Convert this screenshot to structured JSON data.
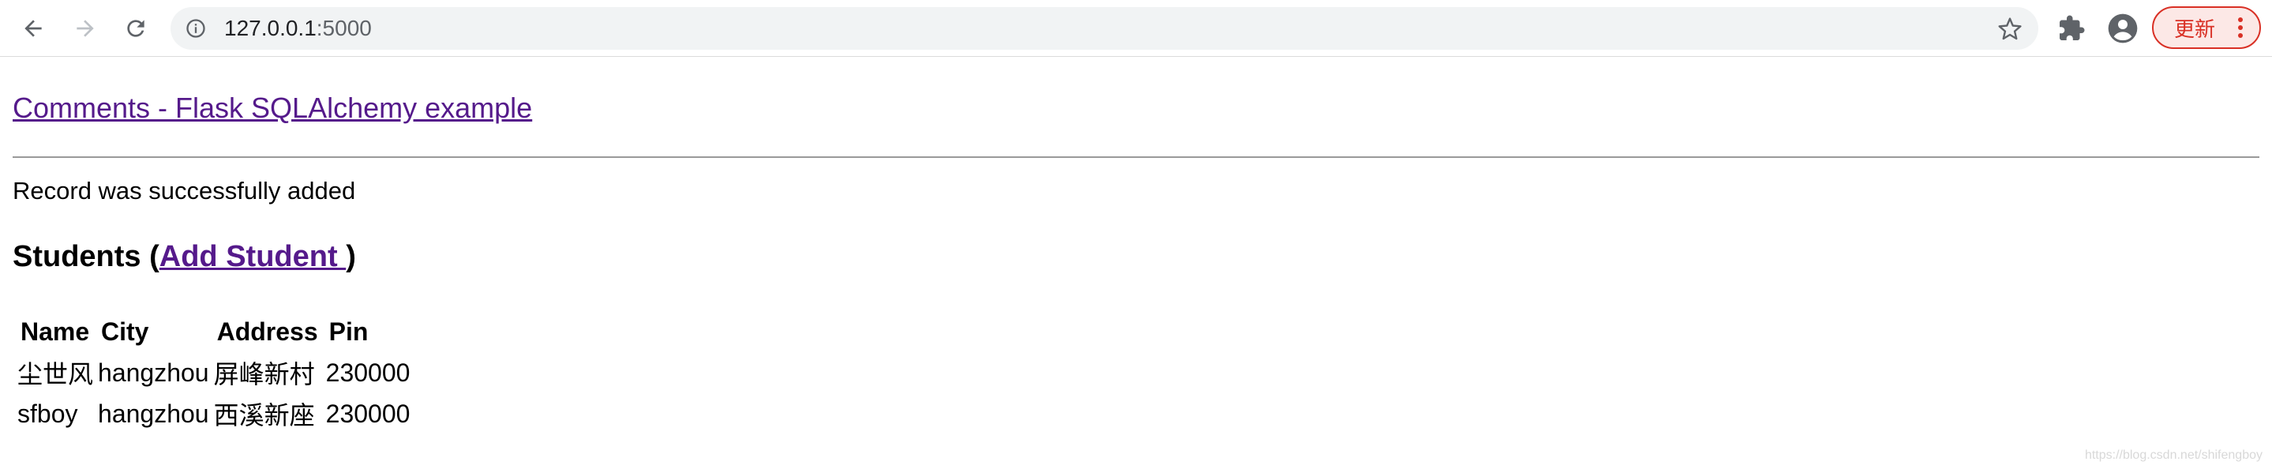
{
  "browser": {
    "url_host": "127.0.0.1",
    "url_port": ":5000",
    "update_label": "更新"
  },
  "page": {
    "title_link": "Comments - Flask SQLAlchemy example",
    "flash_message": "Record was successfully added",
    "students_heading_prefix": "Students (",
    "add_student_link": "Add Student ",
    "students_heading_suffix": ")",
    "table": {
      "headers": [
        "Name",
        "City",
        "Address",
        "Pin"
      ],
      "rows": [
        [
          "尘世风",
          "hangzhou",
          "屏峰新村",
          "230000"
        ],
        [
          "sfboy",
          "hangzhou",
          "西溪新座",
          "230000"
        ]
      ]
    }
  },
  "watermark": "https://blog.csdn.net/shifengboy",
  "colors": {
    "link": "#551a8b",
    "update_accent": "#d93025",
    "omnibox_bg": "#f1f3f4"
  }
}
